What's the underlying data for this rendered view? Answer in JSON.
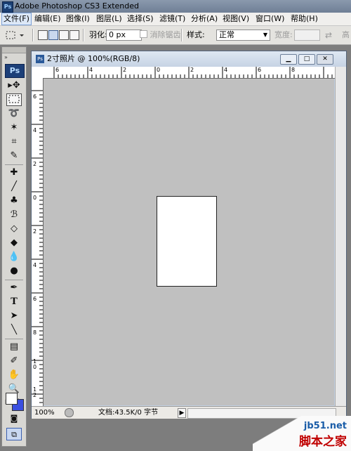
{
  "window": {
    "app_icon": "Ps",
    "title": "Adobe Photoshop CS3 Extended"
  },
  "menu": {
    "items": [
      {
        "label": "文件(F)"
      },
      {
        "label": "编辑(E)"
      },
      {
        "label": "图像(I)"
      },
      {
        "label": "图层(L)"
      },
      {
        "label": "选择(S)"
      },
      {
        "label": "滤镜(T)"
      },
      {
        "label": "分析(A)"
      },
      {
        "label": "视图(V)"
      },
      {
        "label": "窗口(W)"
      },
      {
        "label": "帮助(H)"
      }
    ]
  },
  "options_bar": {
    "feather_label": "羽化:",
    "feather_value": "0 px",
    "antialias_label": "消除锯齿",
    "style_label": "样式:",
    "style_value": "正常",
    "width_label": "宽度:",
    "height_label": "高"
  },
  "tools": {
    "logo": "Ps"
  },
  "document": {
    "tab_title": "2寸照片 @ 100%(RGB/8)",
    "ruler_h_labels": [
      "6",
      "4",
      "2",
      "0",
      "2",
      "4",
      "6",
      "8"
    ],
    "ruler_v_labels": [
      "6",
      "4",
      "2",
      "0",
      "2",
      "4",
      "6",
      "8",
      "10",
      "12"
    ],
    "status": {
      "zoom": "100%",
      "doc_size": "文档:43.5K/0 字节"
    }
  },
  "watermark": {
    "site": "jb51.net",
    "brand": "脚本之家"
  }
}
